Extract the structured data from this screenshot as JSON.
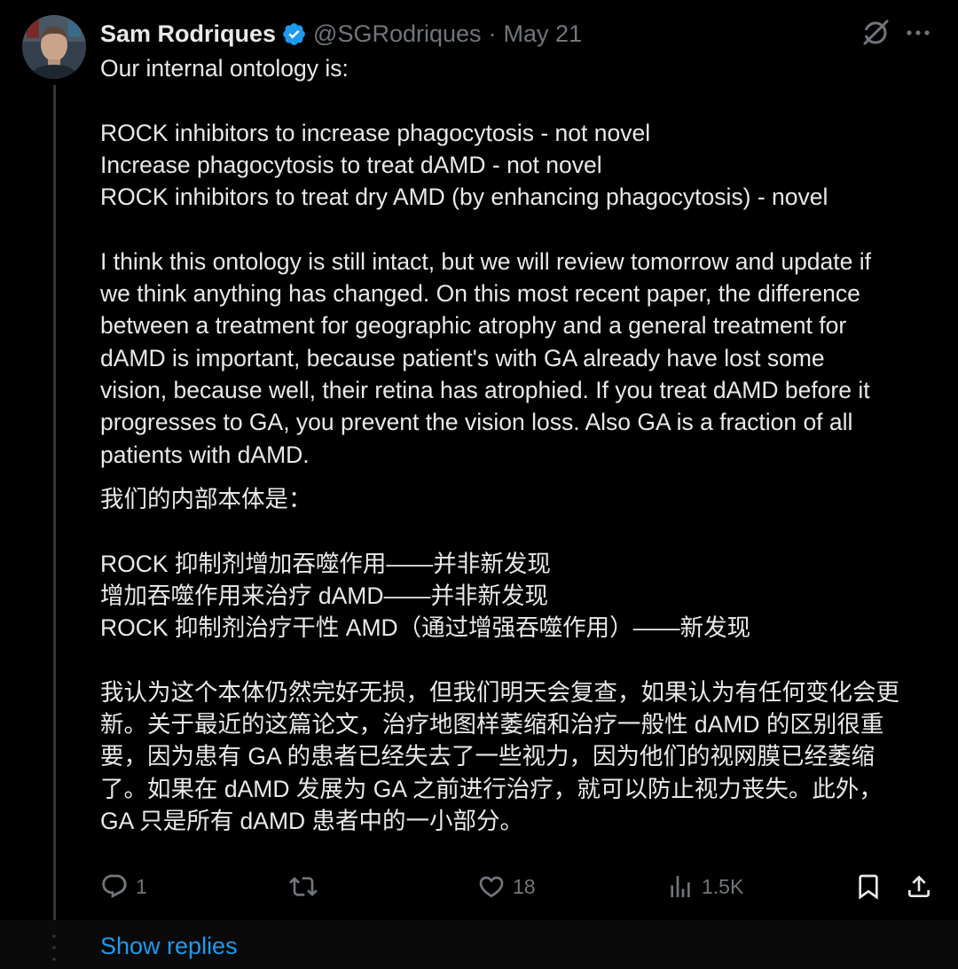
{
  "author": {
    "display_name": "Sam Rodriques",
    "handle": "@SGRodriques",
    "separator": "·",
    "date": "May 21",
    "verified_icon": "verified-badge-icon",
    "avatar_icon": "avatar-photo"
  },
  "post": {
    "english_text": "Our internal ontology is:\n\nROCK inhibitors to increase phagocytosis - not novel\nIncrease phagocytosis to treat dAMD - not novel\nROCK inhibitors to treat dry AMD (by enhancing phagocytosis) - novel\n\nI think this ontology is still intact, but we will review tomorrow and update if\nwe think anything has changed. On this most recent paper, the difference\nbetween a treatment for geographic atrophy and a general treatment for\ndAMD is important, because patient's with GA already have lost some\nvision, because well, their retina has atrophied. If you treat dAMD before it\nprogresses to GA, you prevent the vision loss. Also GA is a fraction of all\npatients with dAMD.",
    "chinese_text": "我们的内部本体是：\n\nROCK 抑制剂增加吞噬作用——并非新发现\n增加吞噬作用来治疗 dAMD——并非新发现\nROCK 抑制剂治疗干性 AMD（通过增强吞噬作用）——新发现\n\n我认为这个本体仍然完好无损，但我们明天会复查，如果认为有任何变化会更\n新。关于最近的这篇论文，治疗地图样萎缩和治疗一般性 dAMD 的区别很重\n要，因为患有 GA 的患者已经失去了一些视力，因为他们的视网膜已经萎缩\n了。如果在 dAMD 发展为 GA 之前进行治疗，就可以防止视力丧失。此外，\nGA 只是所有 dAMD 患者中的一小部分。"
  },
  "actions": {
    "replies": {
      "icon": "reply-icon",
      "count": "1"
    },
    "reposts": {
      "icon": "repost-icon",
      "count": ""
    },
    "likes": {
      "icon": "heart-icon",
      "count": "18"
    },
    "views": {
      "icon": "views-icon",
      "count": "1.5K"
    },
    "bookmark": {
      "icon": "bookmark-icon"
    },
    "share": {
      "icon": "share-icon"
    }
  },
  "top_icons": {
    "grok": "grok-icon",
    "more": "more-icon"
  },
  "footer": {
    "show_replies_label": "Show replies"
  },
  "colors": {
    "background": "#000000",
    "text": "#e7e9ea",
    "muted": "#71767b",
    "accent": "#1d9bf0",
    "thread_line": "#333639"
  }
}
